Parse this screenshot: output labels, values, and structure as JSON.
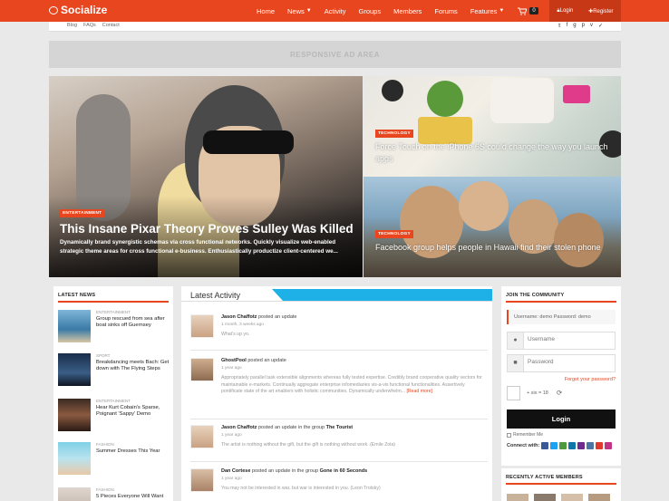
{
  "brand": {
    "name": "Socialize",
    "accent": "#e8461f"
  },
  "nav": {
    "items": [
      {
        "label": "Home",
        "caret": false
      },
      {
        "label": "News",
        "caret": true
      },
      {
        "label": "Activity",
        "caret": false
      },
      {
        "label": "Groups",
        "caret": false
      },
      {
        "label": "Members",
        "caret": false
      },
      {
        "label": "Forums",
        "caret": false
      },
      {
        "label": "Features",
        "caret": true
      }
    ],
    "cart_count": "0",
    "login": "Login",
    "register": "Register"
  },
  "subbar": {
    "links": [
      "Blog",
      "FAQs",
      "Contact"
    ],
    "social_icons": [
      "twitter-icon",
      "facebook-icon",
      "googleplus-icon",
      "pinterest-icon",
      "vimeo-icon",
      "vine-icon"
    ]
  },
  "ad": {
    "label": "RESPONSIVE AD AREA"
  },
  "hero": {
    "main": {
      "category": "ENTERTAINMENT",
      "title": "This Insane Pixar Theory Proves Sulley Was Killed",
      "excerpt": "Dynamically brand synergistic schemas via cross functional networks. Quickly visualize web-enabled strategic theme areas for cross functional e-business. Enthusiastically productize client-centered we..."
    },
    "side": [
      {
        "category": "TECHNOLOGY",
        "title": "Force Touch on the iPhone 6S could change the way you launch apps"
      },
      {
        "category": "TECHNOLOGY",
        "title": "Facebook group helps people in Hawaii find their stolen phone"
      }
    ]
  },
  "latest_news": {
    "title": "LATEST NEWS",
    "items": [
      {
        "category": "ENTERTAINMENT",
        "title": "Group rescued from sea after boat sinks off Guernsey"
      },
      {
        "category": "SPORT",
        "title": "Breakdancing meets Bach: Get down with The Flying Steps"
      },
      {
        "category": "ENTERTAINMENT",
        "title": "Hear Kurt Cobain's Sparse, Poignant 'Sappy' Demo"
      },
      {
        "category": "FASHION",
        "title": "Summer Dresses This Year"
      },
      {
        "category": "FASHION",
        "title": "5 Pieces Everyone Will Want"
      }
    ]
  },
  "activity": {
    "title": "Latest Activity",
    "items": [
      {
        "user": "Jason Chaffotz",
        "action": "posted an update",
        "group": "",
        "time": "1 month, 3 weeks ago",
        "text": "What's up yo.",
        "more": ""
      },
      {
        "user": "GhostPool",
        "action": "posted an update",
        "group": "",
        "time": "1 year ago",
        "text": "Appropriately parallel task extensible alignments whereas fully tested expertise. Credibly brand cooperative quality vectors for maintainable e-markets. Continually aggregate enterprise infomediaries vis-a-vis functional functionalities. Assertively pontificate state of the art enablers with holistic communities. Dynamically underwhelm...",
        "more": "[Read more]"
      },
      {
        "user": "Jason Chaffotz",
        "action": "posted an update in the group",
        "group": "The Tourist",
        "time": "1 year ago",
        "text": "The artist is nothing without the gift, but the gift is nothing without work. (Emile Zola)",
        "more": ""
      },
      {
        "user": "Dan Cortese",
        "action": "posted an update in the group",
        "group": "Gone in 60 Seconds",
        "time": "1 year ago",
        "text": "You may not be interested in war, but war is interested in you. (Leon Trotsky)",
        "more": ""
      }
    ]
  },
  "join": {
    "title": "JOIN THE COMMUNITY",
    "demo": "Username: demo  Password: demo",
    "username_placeholder": "Username",
    "password_placeholder": "Password",
    "forgot": "Forgot your password?",
    "captcha": "+ six = 18",
    "login_button": "Login",
    "remember": "Remember Me",
    "connect_label": "Connect with:",
    "connect_icons": [
      {
        "name": "facebook-icon",
        "color": "#3b5998"
      },
      {
        "name": "twitter-icon",
        "color": "#1da1f2"
      },
      {
        "name": "google-icon",
        "color": "#4f9a3f"
      },
      {
        "name": "linkedin-icon",
        "color": "#0e76a8"
      },
      {
        "name": "yahoo-icon",
        "color": "#6e2a8d"
      },
      {
        "name": "vk-icon",
        "color": "#4c75a3"
      },
      {
        "name": "flickr-icon",
        "color": "#e03a2e"
      },
      {
        "name": "instagram-icon",
        "color": "#c13584"
      }
    ]
  },
  "members": {
    "title": "RECENTLY ACTIVE MEMBERS"
  }
}
